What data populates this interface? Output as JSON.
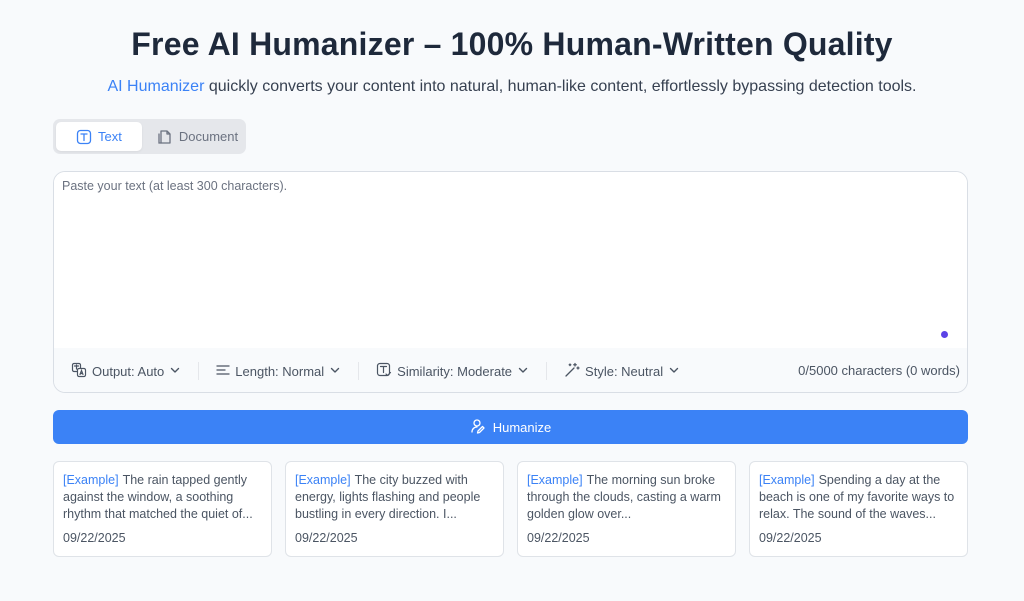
{
  "header": {
    "title": "Free AI Humanizer – 100% Human-Written Quality",
    "subtitle_link": "AI Humanizer",
    "subtitle_rest": " quickly converts your content into natural, human-like content, effortlessly bypassing detection tools."
  },
  "tabs": [
    {
      "label": "Text",
      "icon": "text-icon",
      "active": true
    },
    {
      "label": "Document",
      "icon": "document-icon",
      "active": false
    }
  ],
  "editor": {
    "placeholder": "Paste your text (at least 300 characters).",
    "value": ""
  },
  "options": {
    "output": "Output: Auto",
    "length": "Length: Normal",
    "similarity": "Similarity: Moderate",
    "style": "Style: Neutral",
    "counter": "0/5000 characters (0 words)"
  },
  "humanize_button": {
    "label": "Humanize"
  },
  "examples": [
    {
      "tag": "[Example]",
      "text": "The rain tapped gently against the window, a soothing rhythm that matched the quiet of...",
      "date": "09/22/2025"
    },
    {
      "tag": "[Example]",
      "text": "The city buzzed with energy, lights flashing and people bustling in every direction. I...",
      "date": "09/22/2025"
    },
    {
      "tag": "[Example]",
      "text": "The morning sun broke through the clouds, casting a warm golden glow over...",
      "date": "09/22/2025"
    },
    {
      "tag": "[Example]",
      "text": "Spending a day at the beach is one of my favorite ways to relax. The sound of the waves...",
      "date": "09/22/2025"
    }
  ],
  "colors": {
    "accent": "#3b82f6",
    "indicator": "#5b43e6",
    "background": "#f8fafc"
  }
}
